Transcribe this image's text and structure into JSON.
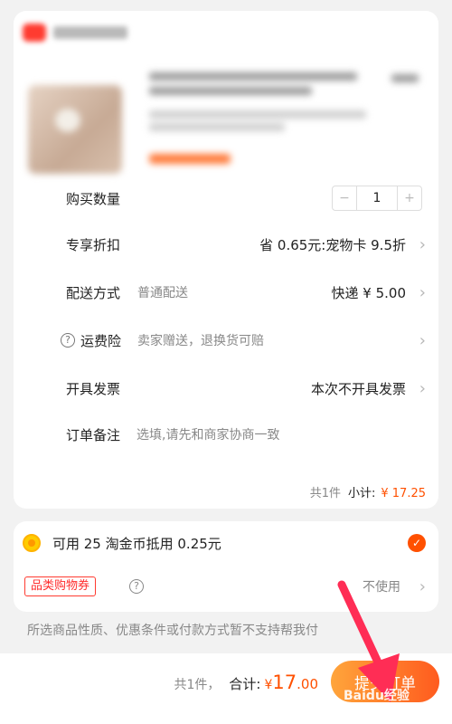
{
  "order": {
    "rows": {
      "quantity": {
        "label": "购买数量",
        "value": "1",
        "minus": "−",
        "plus": "+"
      },
      "discount": {
        "label": "专享折扣",
        "value": "省 0.65元:宠物卡 9.5折"
      },
      "delivery": {
        "label": "配送方式",
        "sub": "普通配送",
        "value": "快递 ¥ 5.00"
      },
      "insurance": {
        "label": "运费险",
        "sub": "卖家赠送，退换货可赔",
        "help_glyph": "?"
      },
      "invoice": {
        "label": "开具发票",
        "value": "本次不开具发票"
      },
      "note": {
        "label": "订单备注",
        "placeholder": "选填,请先和商家协商一致"
      }
    },
    "subtotal": {
      "count": "共1件",
      "label": "小计:",
      "price": "¥ 17.25"
    }
  },
  "coins": {
    "text": "可用 25 淘金币抵用 0.25元",
    "checked": true,
    "check_glyph": "✓",
    "coupon_label": "品类购物券",
    "coupon_help_glyph": "?",
    "coupon_value": "不使用"
  },
  "notice": "所选商品性质、优惠条件或付款方式暂不支持帮我付",
  "footer": {
    "count": "共1件，",
    "total_label": "合计:",
    "currency": "¥",
    "amount": "17",
    "decimal": ".00",
    "submit_label": "提交订单"
  },
  "chevron_glyph": "›",
  "watermark": "Baidu经验",
  "colors": {
    "accent": "#ff5000",
    "arrow": "#ff2d55",
    "coupon_red": "#ff2d2d"
  }
}
